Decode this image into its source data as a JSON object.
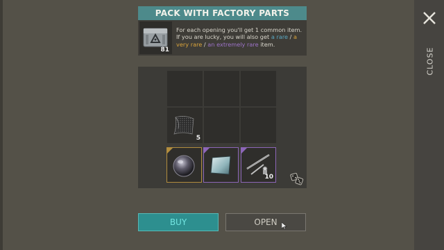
{
  "header": {
    "title": "PACK WITH FACTORY PARTS"
  },
  "pack": {
    "count": "81",
    "icon": "factory-crate-icon"
  },
  "description": {
    "intro": "For each opening you'll get 1 common item. If you are lucky, you will also get ",
    "rare": "a rare",
    "sep1": " / ",
    "very_rare": "a very rare",
    "sep2": " / ",
    "extremely_rare": "an extremely rare",
    "outro": " item."
  },
  "close": {
    "label": "CLOSE"
  },
  "grid": {
    "slots": [
      {
        "item": "",
        "qty": "",
        "rarity": ""
      },
      {
        "item": "",
        "qty": "",
        "rarity": ""
      },
      {
        "item": "",
        "qty": "",
        "rarity": ""
      },
      {
        "item": "carbon-fabric-icon",
        "qty": "5",
        "rarity": ""
      },
      {
        "item": "",
        "qty": "",
        "rarity": ""
      },
      {
        "item": "",
        "qty": "",
        "rarity": ""
      },
      {
        "item": "glass-lens-icon",
        "qty": "",
        "rarity": "common"
      },
      {
        "item": "metal-plate-icon",
        "qty": "",
        "rarity": "rare"
      },
      {
        "item": "tools-parts-icon",
        "qty": "10",
        "rarity": "rare"
      }
    ]
  },
  "buttons": {
    "buy": "BUY",
    "open": "OPEN"
  },
  "colors": {
    "header": "#4d8a8b",
    "common": "#b28d3e",
    "rare": "#8d66b8",
    "rare_text": "#5aa7c2",
    "very_rare_text": "#d9a33b",
    "extremely_rare_text": "#9d73c8",
    "buy": "#2d8f8f"
  }
}
